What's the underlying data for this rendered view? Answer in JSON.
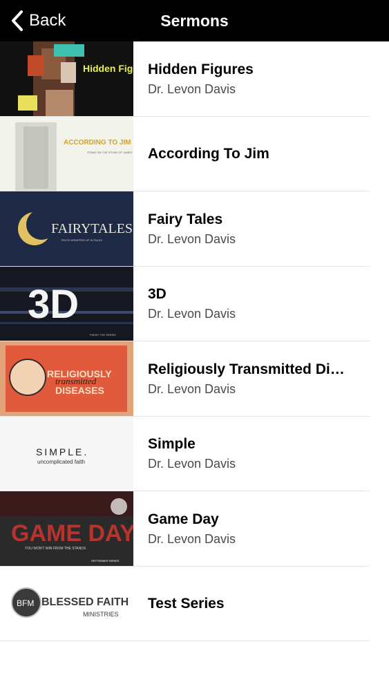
{
  "navbar": {
    "back_label": "Back",
    "title": "Sermons"
  },
  "sermons": [
    {
      "title": "Hidden Figures",
      "speaker": "Dr. Levon Davis",
      "thumb_text": "Hidden Figures"
    },
    {
      "title": "According To Jim",
      "speaker": "",
      "thumb_text": "ACCORDING TO JIM"
    },
    {
      "title": "Fairy Tales",
      "speaker": "Dr. Levon Davis",
      "thumb_text": "FAIRYTALES"
    },
    {
      "title": "3D",
      "speaker": "Dr. Levon Davis",
      "thumb_text": "3D"
    },
    {
      "title": "Religiously Transmitted Di…",
      "speaker": "Dr. Levon Davis",
      "thumb_text": "RELIGIOUSLY transmitted DISEASES"
    },
    {
      "title": "Simple",
      "speaker": "Dr. Levon Davis",
      "thumb_text": "SIMPLE. uncomplicated faith"
    },
    {
      "title": "Game Day",
      "speaker": "Dr. Levon Davis",
      "thumb_text": "GAME DAY"
    },
    {
      "title": "Test Series",
      "speaker": "",
      "thumb_text": "BFM BLESSED FAITH MINISTRIES"
    }
  ],
  "thumb_details": {
    "according_sub": "STAND ON THE STONE OF JAMES",
    "fairy_sub": "TRUTH WRAPPED UP IN TALES",
    "three_d_sub": "FINISH THE SERIES",
    "religiously_top": "RELIGIOUSLY",
    "religiously_mid": "transmitted",
    "religiously_bot": "DISEASES",
    "simple_top": "SIMPLE.",
    "simple_bot": "uncomplicated faith",
    "game_sub": "YOU WON'T WIN FROM THE STANDS",
    "game_series": "SEPTEMBER SERIES",
    "bfm_mark": "BFM",
    "bfm_top": "BLESSED FAITH",
    "bfm_bot": "MINISTRIES"
  },
  "colors": {
    "navbar_bg": "#000000",
    "separator": "#e3e3e3",
    "subtitle": "#4a4a4a"
  },
  "icons": {
    "back": "chevron-left-icon"
  }
}
